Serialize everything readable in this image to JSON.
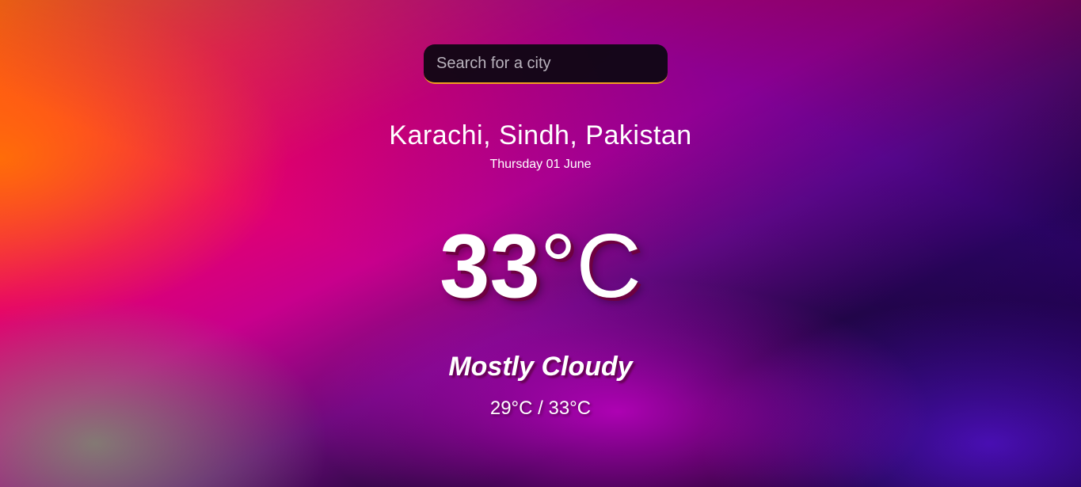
{
  "search": {
    "placeholder": "Search for a city",
    "accent_color": "#f0a020"
  },
  "weather": {
    "location": "Karachi, Sindh, Pakistan",
    "date": "Thursday 01 June",
    "temperature": "33",
    "unit": "°C",
    "condition": "Mostly Cloudy",
    "range": "29°C / 33°C"
  }
}
